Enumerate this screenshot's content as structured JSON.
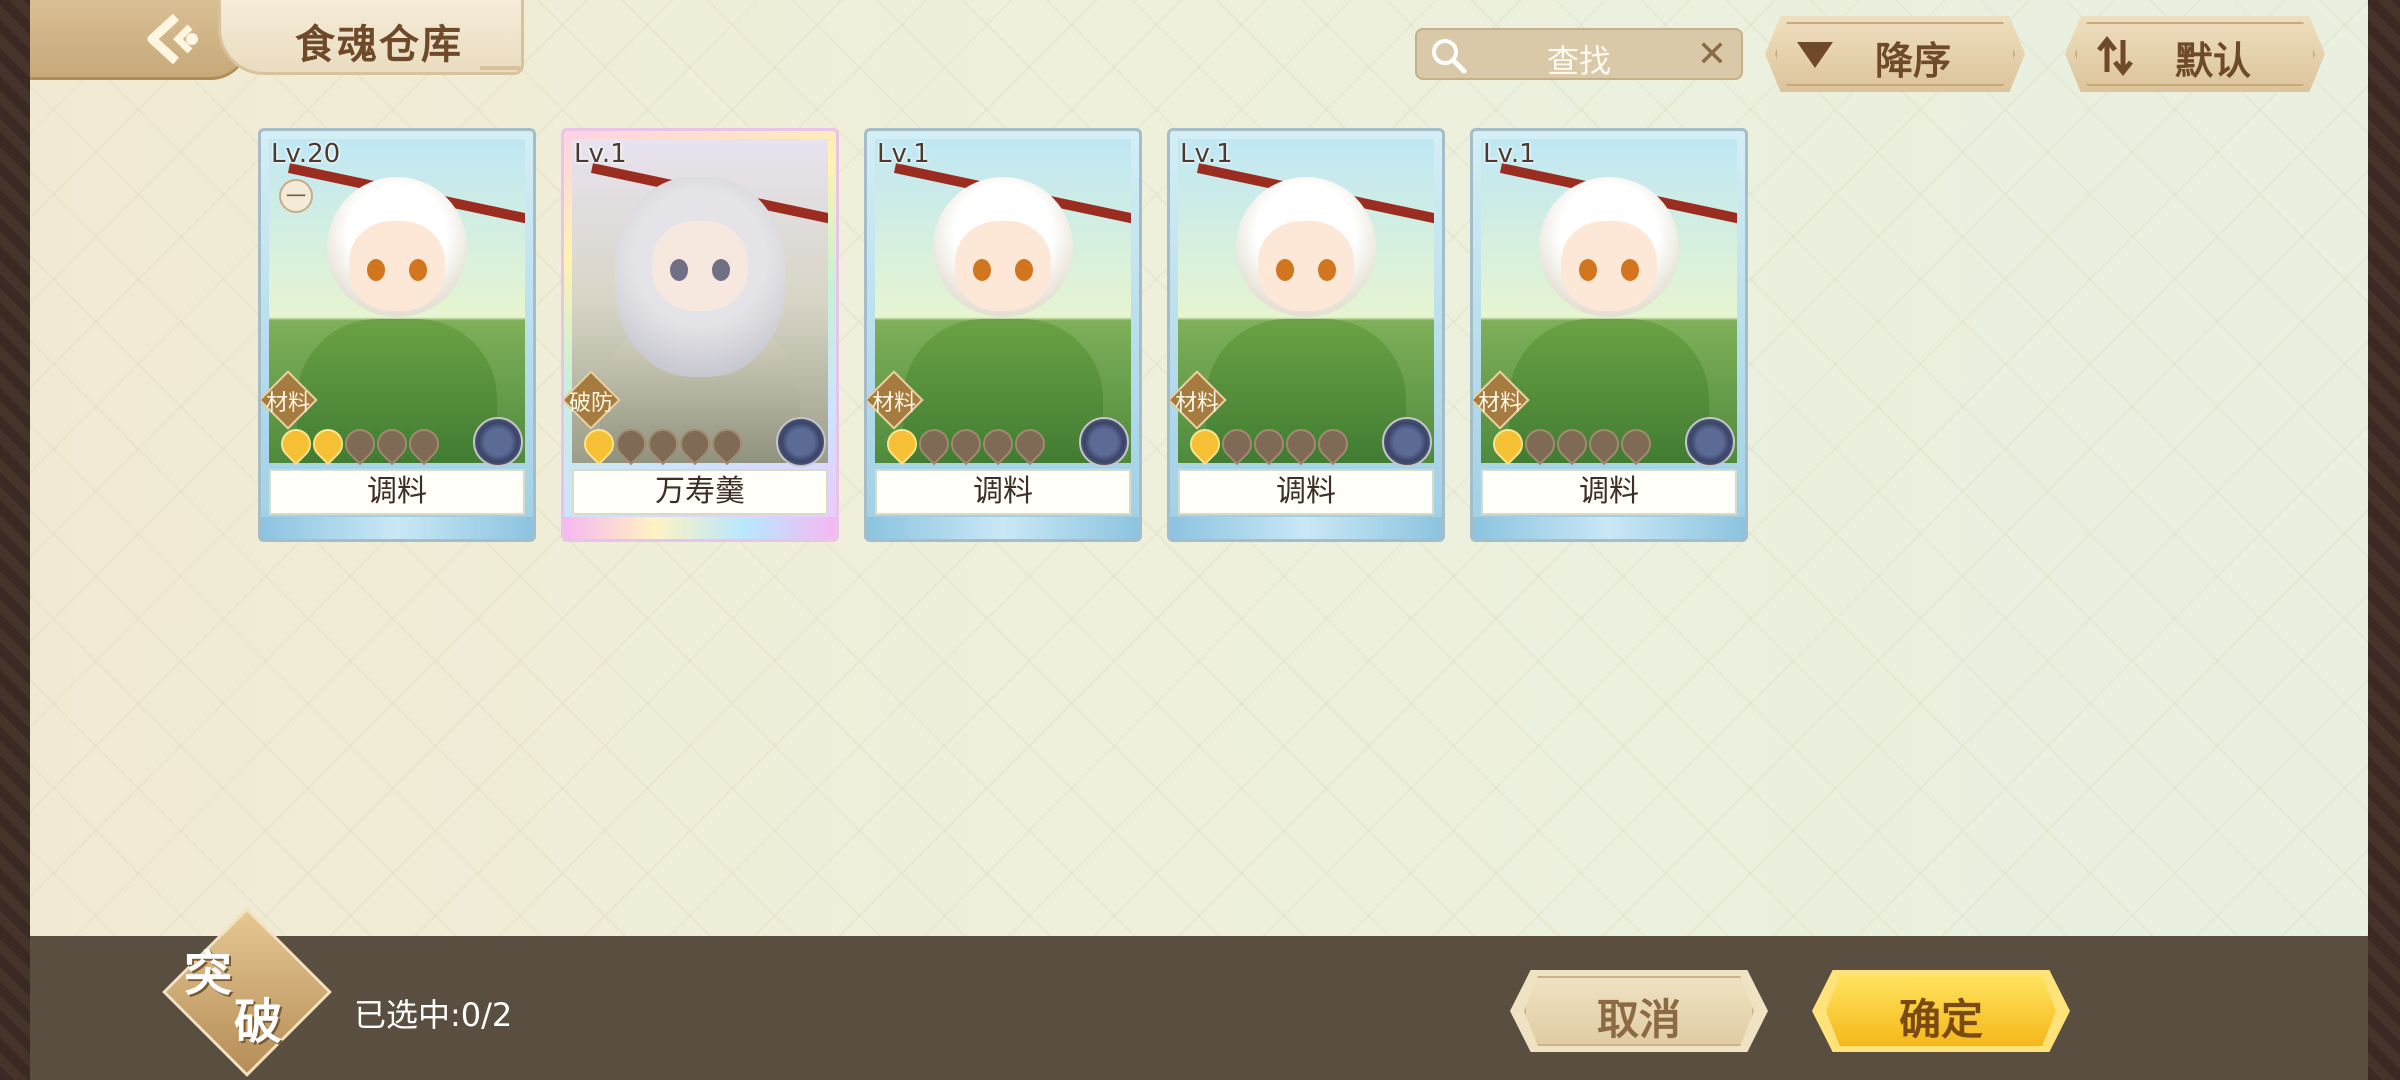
{
  "header": {
    "title": "食魂仓库",
    "search": {
      "placeholder": "查找"
    },
    "sort_order_label": "降序",
    "sort_mode_label": "默认"
  },
  "cards": [
    {
      "level": "Lv.20",
      "tag": "材料",
      "name": "调料",
      "stars_lit": 2,
      "locked": true
    },
    {
      "level": "Lv.1",
      "tag": "破防",
      "name": "万寿羹",
      "stars_lit": 1,
      "locked": false
    },
    {
      "level": "Lv.1",
      "tag": "材料",
      "name": "调料",
      "stars_lit": 1,
      "locked": false
    },
    {
      "level": "Lv.1",
      "tag": "材料",
      "name": "调料",
      "stars_lit": 1,
      "locked": false
    },
    {
      "level": "Lv.1",
      "tag": "材料",
      "name": "调料",
      "stars_lit": 1,
      "locked": false
    }
  ],
  "lock_badge_text": "一",
  "footer": {
    "badge_top": "突",
    "badge_bottom": "破",
    "selected_label": "已选中:0/2",
    "cancel_label": "取消",
    "confirm_label": "确定"
  },
  "icons": {
    "back": "back-chevron-icon",
    "search": "magnifier-icon",
    "clear": "close-icon",
    "sort_order": "triangle-down-icon",
    "sort_mode": "swap-arrows-icon"
  },
  "colors": {
    "accent": "#6e4a2a",
    "confirm": "#f5c033",
    "bar": "#5a4e40"
  }
}
